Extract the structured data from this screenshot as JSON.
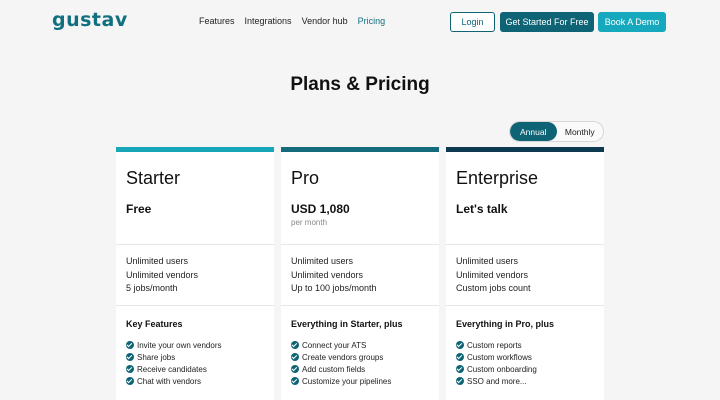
{
  "header": {
    "logo": "gustav",
    "nav": [
      "Features",
      "Integrations",
      "Vendor hub",
      "Pricing"
    ],
    "login_label": "Login",
    "get_started_label": "Get Started For Free",
    "book_demo_label": "Book A Demo"
  },
  "page_title": "Plans & Pricing",
  "billing_toggle": {
    "options": [
      "Annual",
      "Monthly"
    ],
    "selected": "Annual"
  },
  "colors": {
    "starter": "#17a6b8",
    "pro": "#136b7c",
    "enterprise": "#0d3a50",
    "primary": "#0e6475",
    "accent": "#16a9bd"
  },
  "plans": [
    {
      "name": "Starter",
      "price": "Free",
      "period": "",
      "stats": [
        "Unlimited users",
        "Unlimited vendors",
        "5 jobs/month"
      ],
      "features_title": "Key Features",
      "features": [
        "Invite your own vendors",
        "Share jobs",
        "Receive candidates",
        "Chat with vendors"
      ]
    },
    {
      "name": "Pro",
      "price": "USD 1,080",
      "period": "per month",
      "stats": [
        "Unlimited users",
        "Unlimited vendors",
        "Up to 100 jobs/month"
      ],
      "features_title": "Everything in Starter, plus",
      "features": [
        "Connect your ATS",
        "Create vendors groups",
        "Add custom fields",
        "Customize your pipelines"
      ]
    },
    {
      "name": "Enterprise",
      "price": "Let's talk",
      "period": "",
      "stats": [
        "Unlimited users",
        "Unlimited vendors",
        "Custom jobs count"
      ],
      "features_title": "Everything in Pro, plus",
      "features": [
        "Custom reports",
        "Custom workflows",
        "Custom onboarding",
        "SSO and more..."
      ]
    }
  ]
}
